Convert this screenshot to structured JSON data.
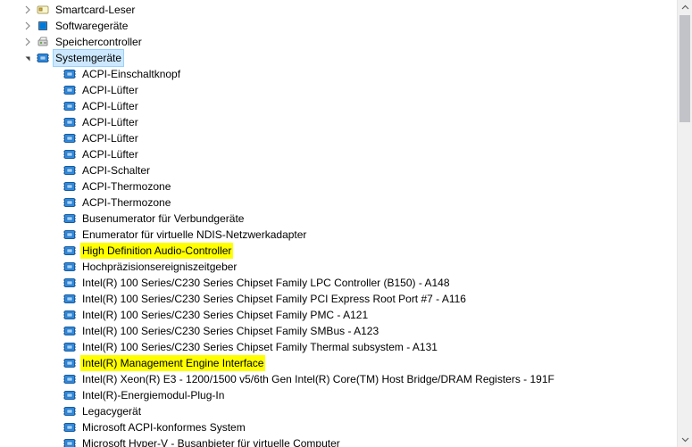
{
  "tree": {
    "categories": [
      {
        "label": "Smartcard-Leser",
        "icon": "smartcard",
        "exp": "collapsed"
      },
      {
        "label": "Softwaregeräte",
        "icon": "software",
        "exp": "collapsed"
      },
      {
        "label": "Speichercontroller",
        "icon": "storage",
        "exp": "collapsed"
      },
      {
        "label": "Systemgeräte",
        "icon": "system",
        "exp": "expanded",
        "selected": true
      }
    ],
    "system_devices": [
      {
        "label": "ACPI-Einschaltknopf",
        "icon": "system"
      },
      {
        "label": "ACPI-Lüfter",
        "icon": "system"
      },
      {
        "label": "ACPI-Lüfter",
        "icon": "system"
      },
      {
        "label": "ACPI-Lüfter",
        "icon": "system"
      },
      {
        "label": "ACPI-Lüfter",
        "icon": "system"
      },
      {
        "label": "ACPI-Lüfter",
        "icon": "system"
      },
      {
        "label": "ACPI-Schalter",
        "icon": "system"
      },
      {
        "label": "ACPI-Thermozone",
        "icon": "system"
      },
      {
        "label": "ACPI-Thermozone",
        "icon": "system"
      },
      {
        "label": "Busenumerator für Verbundgeräte",
        "icon": "system"
      },
      {
        "label": "Enumerator für virtuelle NDIS-Netzwerkadapter",
        "icon": "system"
      },
      {
        "label": "High Definition Audio-Controller",
        "icon": "system",
        "highlight": true
      },
      {
        "label": "Hochpräzisionsereigniszeitgeber",
        "icon": "system"
      },
      {
        "label": "Intel(R) 100 Series/C230 Series Chipset Family LPC Controller (B150) - A148",
        "icon": "system"
      },
      {
        "label": "Intel(R) 100 Series/C230 Series Chipset Family PCI Express Root Port #7 - A116",
        "icon": "system"
      },
      {
        "label": "Intel(R) 100 Series/C230 Series Chipset Family PMC - A121",
        "icon": "system"
      },
      {
        "label": "Intel(R) 100 Series/C230 Series Chipset Family SMBus - A123",
        "icon": "system"
      },
      {
        "label": "Intel(R) 100 Series/C230 Series Chipset Family Thermal subsystem - A131",
        "icon": "system"
      },
      {
        "label": "Intel(R) Management Engine Interface",
        "icon": "system",
        "highlight": true
      },
      {
        "label": "Intel(R) Xeon(R) E3 - 1200/1500 v5/6th Gen Intel(R) Core(TM) Host Bridge/DRAM Registers - 191F",
        "icon": "system"
      },
      {
        "label": "Intel(R)-Energiemodul-Plug-In",
        "icon": "system"
      },
      {
        "label": "Legacygerät",
        "icon": "system"
      },
      {
        "label": "Microsoft ACPI-konformes System",
        "icon": "system"
      },
      {
        "label": "Microsoft Hyper-V - Busanbieter für virtuelle Computer",
        "icon": "system"
      }
    ]
  }
}
